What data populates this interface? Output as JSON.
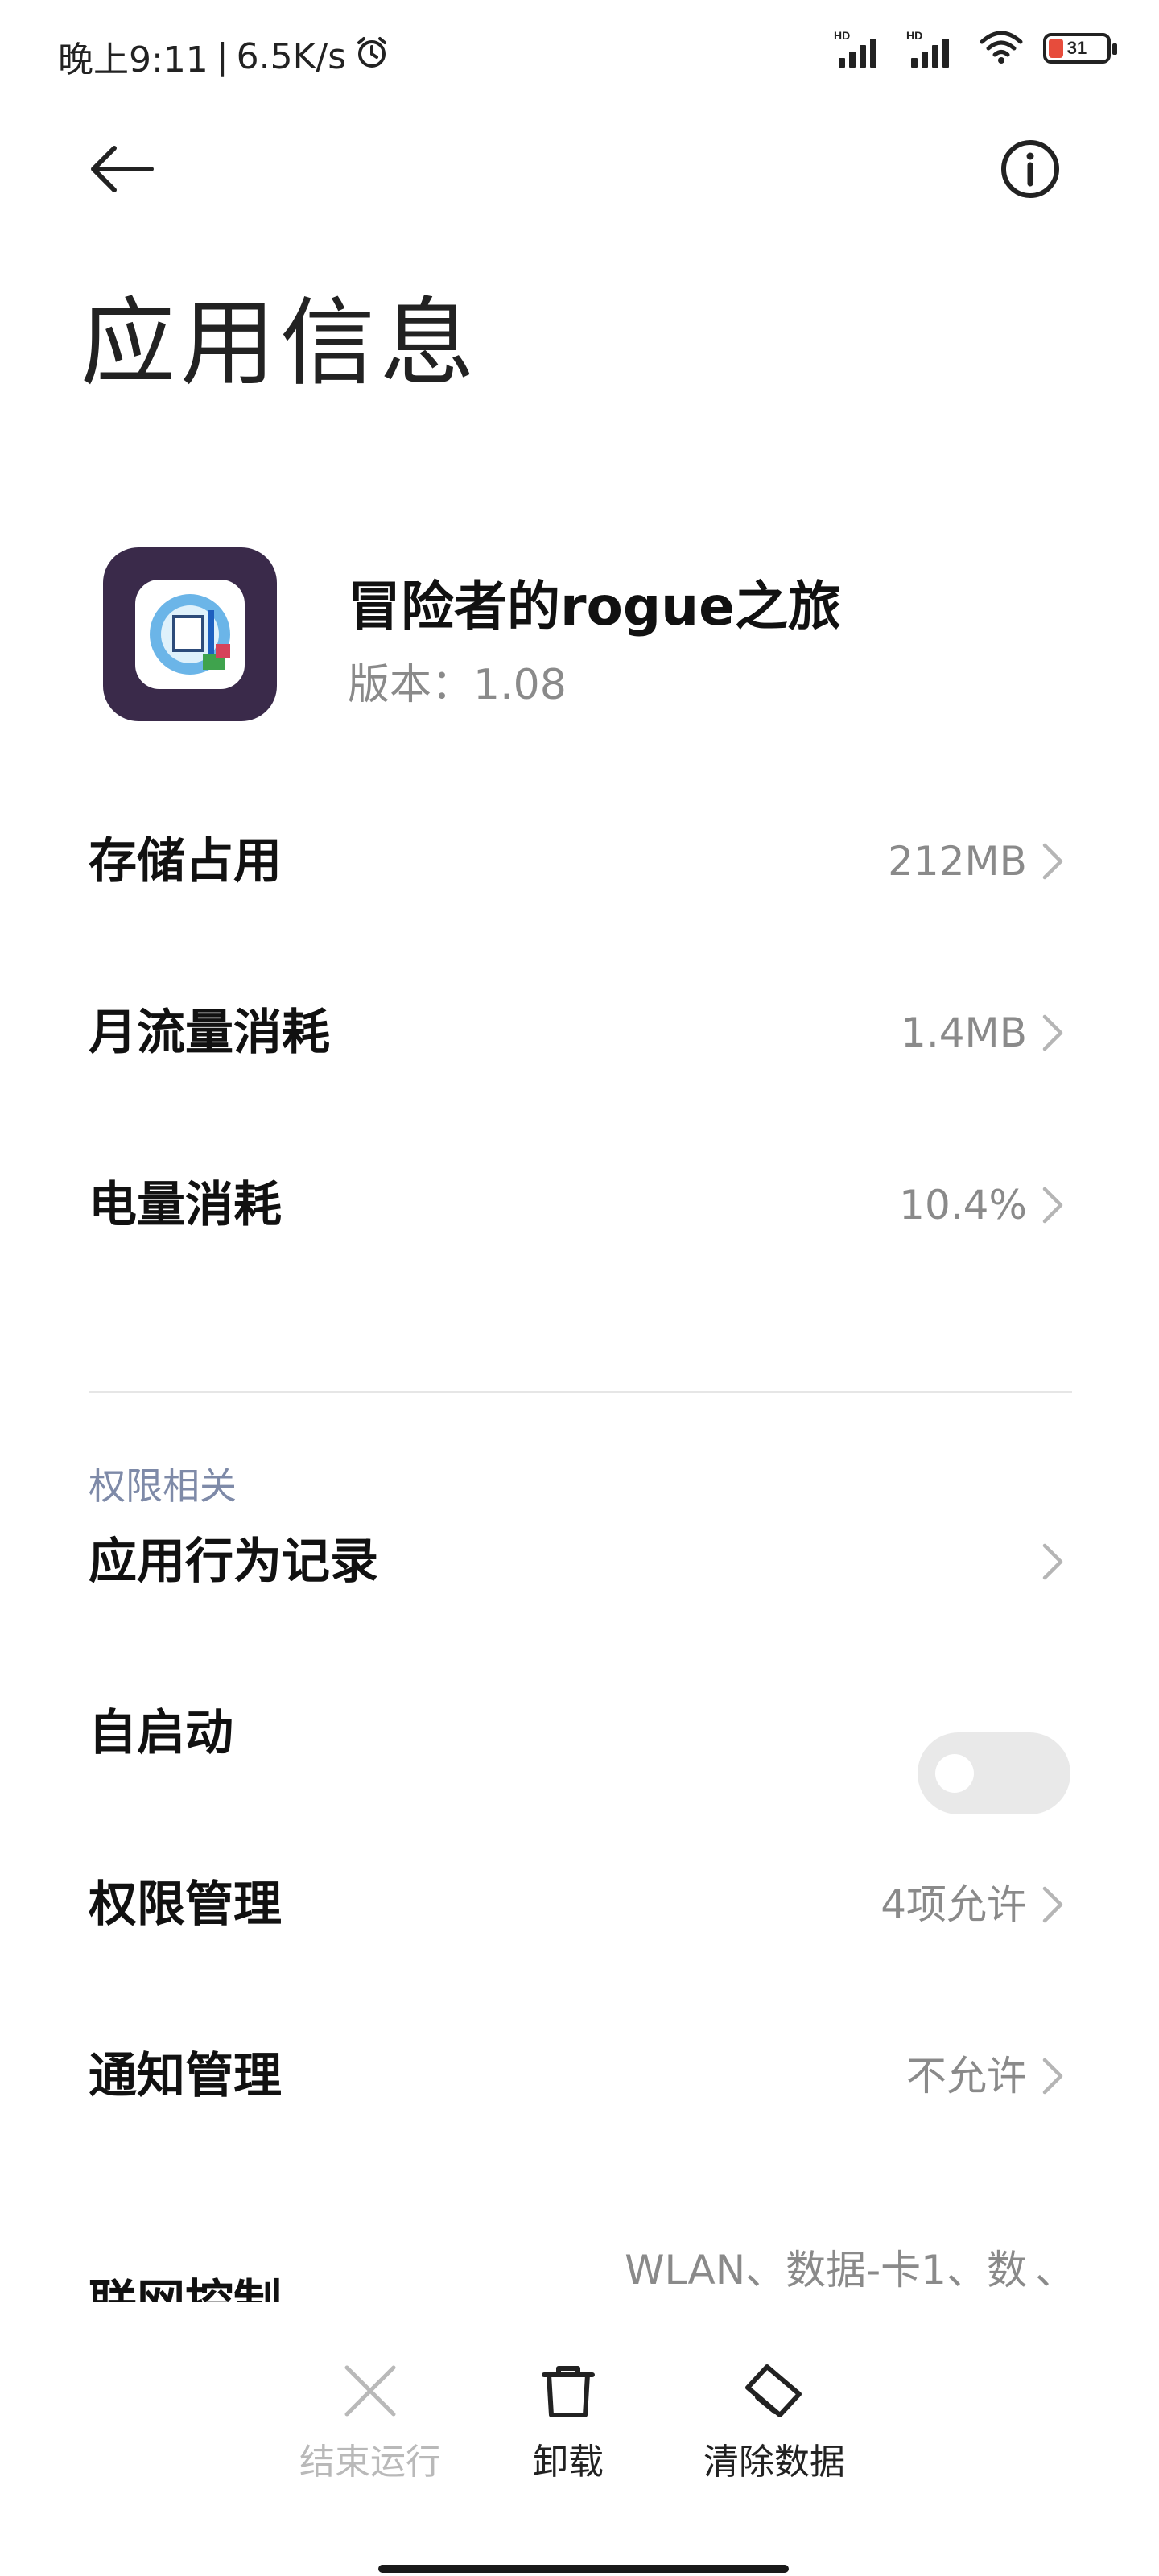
{
  "status_bar": {
    "time": "晚上9:11",
    "separator": "|",
    "speed": "6.5K/s",
    "alarm_icon": "alarm-clock-icon",
    "sim1_hd": "HD",
    "sim2_hd": "HD",
    "battery_level": "31",
    "battery_color": "#e74c3c"
  },
  "header": {
    "title": "应用信息",
    "back_icon": "back-arrow-icon",
    "info_icon": "info-icon"
  },
  "app": {
    "name": "冒险者的rogue之旅",
    "version": "版本：1.08",
    "icon": "app-icon-adventurer"
  },
  "usage_rows": [
    {
      "label": "存储占用",
      "value": "212MB"
    },
    {
      "label": "月流量消耗",
      "value": "1.4MB"
    },
    {
      "label": "电量消耗",
      "value": "10.4%"
    }
  ],
  "permissions": {
    "section_title": "权限相关",
    "behavior_log": {
      "label": "应用行为记录"
    },
    "autostart": {
      "label": "自启动",
      "enabled": false
    },
    "permission_manage": {
      "label": "权限管理",
      "value": "4项允许"
    },
    "notification_manage": {
      "label": "通知管理",
      "value": "不允许"
    },
    "network_control": {
      "label": "联网控制",
      "value": "WLAN、数据-卡1、数",
      "more": "、"
    }
  },
  "bottom_actions": [
    {
      "label": "结束运行",
      "icon": "close-icon",
      "enabled": false
    },
    {
      "label": "卸载",
      "icon": "trash-icon",
      "enabled": true
    },
    {
      "label": "清除数据",
      "icon": "eraser-icon",
      "enabled": true
    }
  ],
  "colors": {
    "accent_section": "#7e8aa8",
    "secondary_text": "#8a8a8a",
    "toggle_off": "#e9e9e9",
    "app_icon_bg": "#3a2a4a"
  }
}
